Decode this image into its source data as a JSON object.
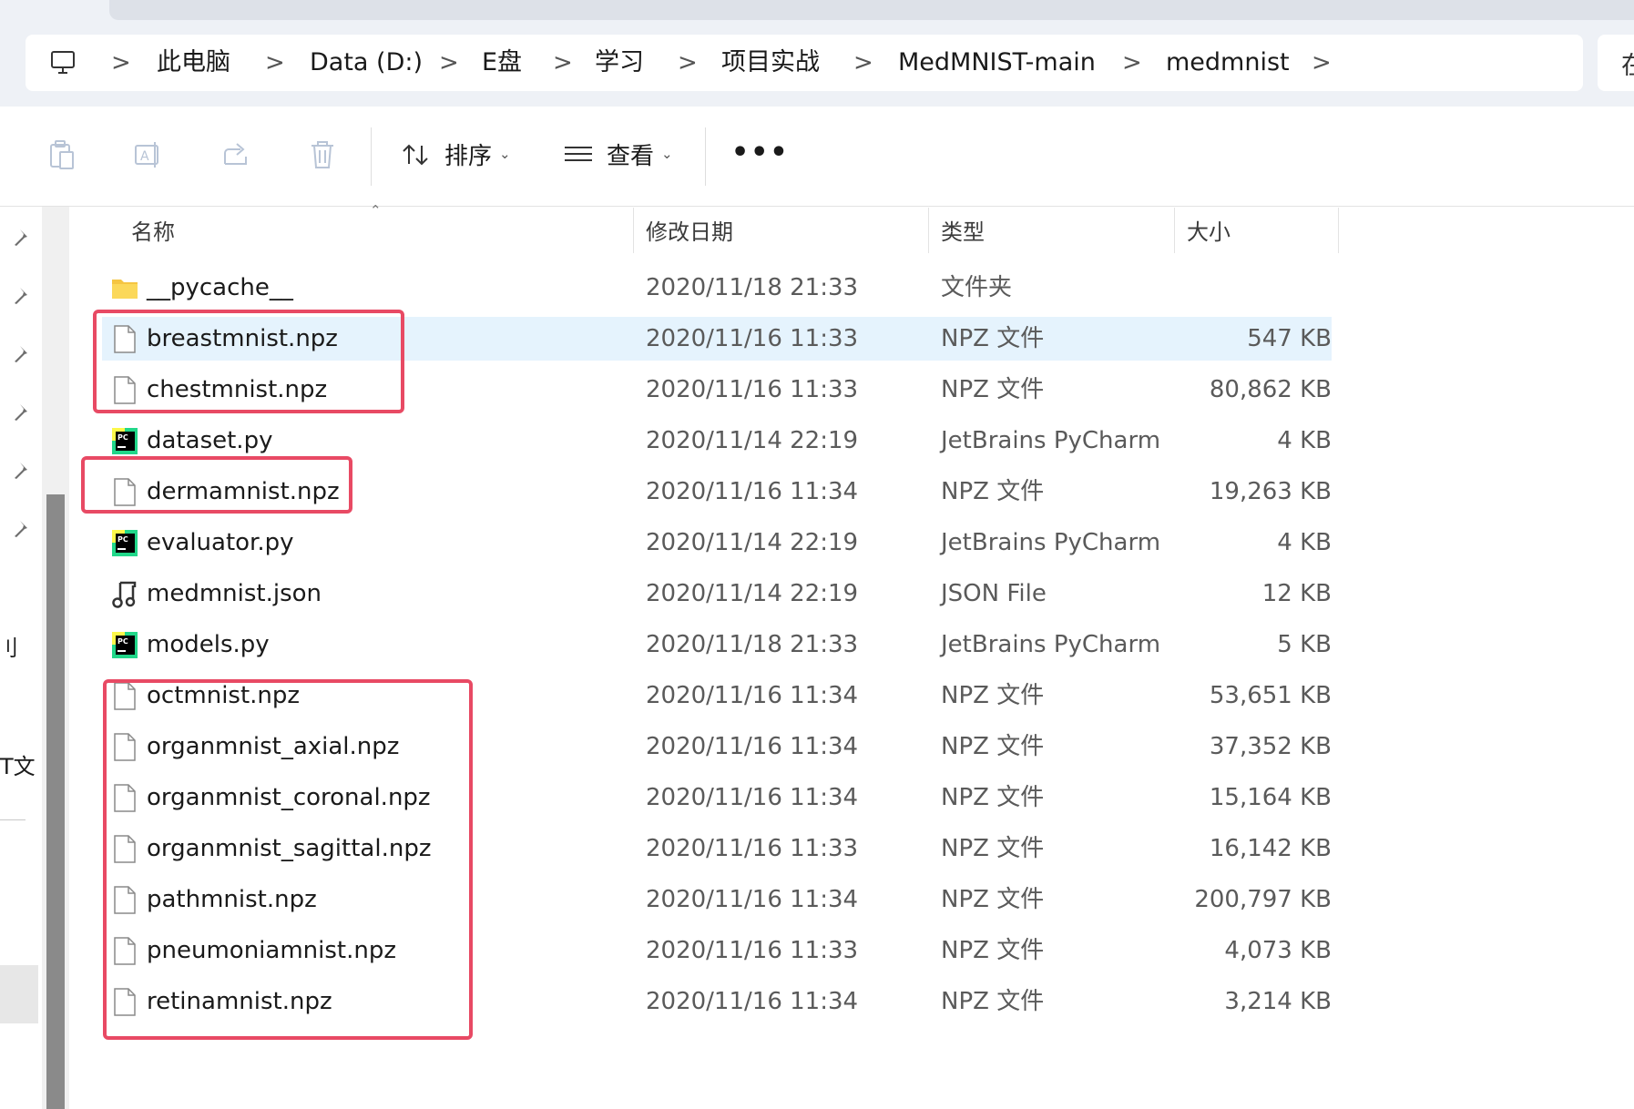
{
  "breadcrumb": {
    "items": [
      "此电脑",
      "Data (D:)",
      "E盘",
      "学习",
      "项目实战",
      "MedMNIST-main",
      "medmnist"
    ],
    "separator": ">",
    "search_partial": "在"
  },
  "toolbar": {
    "sort_label": "排序",
    "view_label": "查看",
    "more_label": "•••"
  },
  "nav": {
    "partial_label_1": "刂",
    "partial_label_2": "T文"
  },
  "columns": {
    "name": "名称",
    "date": "修改日期",
    "type": "类型",
    "size": "大小"
  },
  "files": [
    {
      "name": "__pycache__",
      "date": "2020/11/18 21:33",
      "type": "文件夹",
      "size": "",
      "icon": "folder-icon"
    },
    {
      "name": "breastmnist.npz",
      "date": "2020/11/16 11:33",
      "type": "NPZ 文件",
      "size": "547 KB",
      "icon": "file-icon",
      "selected": true
    },
    {
      "name": "chestmnist.npz",
      "date": "2020/11/16 11:33",
      "type": "NPZ 文件",
      "size": "80,862 KB",
      "icon": "file-icon"
    },
    {
      "name": "dataset.py",
      "date": "2020/11/14 22:19",
      "type": "JetBrains PyCharm",
      "size": "4 KB",
      "icon": "pycharm-icon"
    },
    {
      "name": "dermamnist.npz",
      "date": "2020/11/16 11:34",
      "type": "NPZ 文件",
      "size": "19,263 KB",
      "icon": "file-icon"
    },
    {
      "name": "evaluator.py",
      "date": "2020/11/14 22:19",
      "type": "JetBrains PyCharm",
      "size": "4 KB",
      "icon": "pycharm-icon"
    },
    {
      "name": "medmnist.json",
      "date": "2020/11/14 22:19",
      "type": "JSON File",
      "size": "12 KB",
      "icon": "json-icon"
    },
    {
      "name": "models.py",
      "date": "2020/11/18 21:33",
      "type": "JetBrains PyCharm",
      "size": "5 KB",
      "icon": "pycharm-icon"
    },
    {
      "name": "octmnist.npz",
      "date": "2020/11/16 11:34",
      "type": "NPZ 文件",
      "size": "53,651 KB",
      "icon": "file-icon"
    },
    {
      "name": "organmnist_axial.npz",
      "date": "2020/11/16 11:34",
      "type": "NPZ 文件",
      "size": "37,352 KB",
      "icon": "file-icon"
    },
    {
      "name": "organmnist_coronal.npz",
      "date": "2020/11/16 11:34",
      "type": "NPZ 文件",
      "size": "15,164 KB",
      "icon": "file-icon"
    },
    {
      "name": "organmnist_sagittal.npz",
      "date": "2020/11/16 11:33",
      "type": "NPZ 文件",
      "size": "16,142 KB",
      "icon": "file-icon"
    },
    {
      "name": "pathmnist.npz",
      "date": "2020/11/16 11:34",
      "type": "NPZ 文件",
      "size": "200,797 KB",
      "icon": "file-icon"
    },
    {
      "name": "pneumoniamnist.npz",
      "date": "2020/11/16 11:33",
      "type": "NPZ 文件",
      "size": "4,073 KB",
      "icon": "file-icon"
    },
    {
      "name": "retinamnist.npz",
      "date": "2020/11/16 11:34",
      "type": "NPZ 文件",
      "size": "3,214 KB",
      "icon": "file-icon"
    }
  ],
  "colors": {
    "annotation_red": "#e84a64",
    "selection": "#e5f3fd",
    "folder": "#f5c542",
    "pycharm_green": "#21d789"
  }
}
